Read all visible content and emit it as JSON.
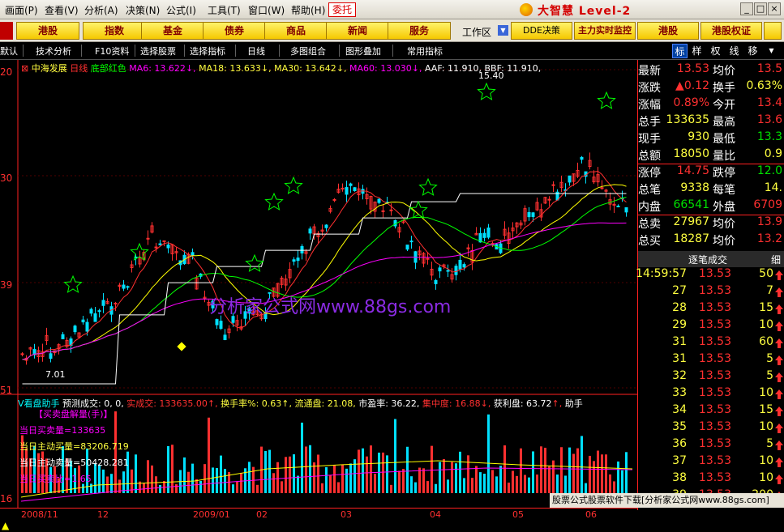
{
  "menu": {
    "items": [
      "画面(P)",
      "查看(V)",
      "分析(A)",
      "决策(N)",
      "公式(I)",
      "工具(T)",
      "窗口(W)",
      "帮助(H)"
    ],
    "entrust": "委托",
    "brand": "大智慧 Level-2"
  },
  "nav": {
    "buttons": [
      "港股",
      "指数",
      "基金",
      "债券",
      "商品",
      "新闻",
      "服务"
    ],
    "workarea": "工作区",
    "right_buttons": [
      "DDE决策",
      "主力实时监控",
      "港股",
      "港股权证"
    ]
  },
  "toolbar": {
    "items": [
      "默认",
      "技术分析",
      "F10资料",
      "选择股票",
      "选择指标",
      "日线",
      "多图组合",
      "图形叠加",
      "常用指标"
    ],
    "side_tabs": [
      "标",
      "样",
      "权",
      "线",
      "移"
    ]
  },
  "chart": {
    "stock_name": "中海发展",
    "period": "日线",
    "indicator": "底部红色",
    "ma6": "MA6: 13.622",
    "ma18": "MA18: 13.633",
    "ma30": "MA30: 13.642",
    "ma60": "MA60: 13.030",
    "aaf": "AAF: 11.910,",
    "bbf": "BBF: 11.910,",
    "high_mark": "15.40",
    "low_mark": "7.01",
    "axis": [
      "20",
      "30",
      "39",
      "51",
      "16"
    ],
    "watermark": "分析家公式网www.88gs.com"
  },
  "vol_panel": {
    "title": "V看盘助手",
    "predict": "预测成交: 0, 0,",
    "actual": "实成交: 133635.00",
    "turnover": "换手率%: 0.63",
    "float_cap": "流通盘: 21.08",
    "pe": "市盈率: 36.22",
    "concentration": "集中度: 16.88",
    "profit": "获利盘: 63.72",
    "helper": "助手",
    "subtitle": "【买卖盘解量(手)】",
    "lines": [
      "当日买卖量=133635",
      "当日主动买量=83206.719",
      "当日主动卖量=50428.281",
      "当日买卖比=1.65"
    ]
  },
  "timeline": {
    "months": [
      "2008/11",
      "12",
      "2009/01",
      "02",
      "03",
      "04",
      "05",
      "06"
    ]
  },
  "quote": {
    "rows": [
      {
        "l1": "最新",
        "v1": "13.53",
        "l2": "均价",
        "v2": "13.5",
        "c1": "#ff3030",
        "c2": "#ff3030"
      },
      {
        "l1": "涨跌",
        "v1": "▲0.12",
        "l2": "换手",
        "v2": "0.63%",
        "c1": "#ff3030",
        "c2": "#ffff40"
      },
      {
        "l1": "涨幅",
        "v1": "0.89%",
        "l2": "今开",
        "v2": "13.4",
        "c1": "#ff3030",
        "c2": "#ff3030"
      },
      {
        "l1": "总手",
        "v1": "133635",
        "l2": "最高",
        "v2": "13.6",
        "c1": "#ffff40",
        "c2": "#ff3030"
      },
      {
        "l1": "现手",
        "v1": "930",
        "l2": "最低",
        "v2": "13.3",
        "c1": "#ffff40",
        "c2": "#00e000"
      },
      {
        "l1": "总额",
        "v1": "18050",
        "l2": "量比",
        "v2": "0.9",
        "c1": "#ffff40",
        "c2": "#ffff40"
      },
      {
        "l1": "涨停",
        "v1": "14.75",
        "l2": "跌停",
        "v2": "12.0",
        "c1": "#ff3030",
        "c2": "#00e000"
      },
      {
        "l1": "总笔",
        "v1": "9338",
        "l2": "每笔",
        "v2": "14.",
        "c1": "#ffff40",
        "c2": "#ffff40"
      },
      {
        "l1": "内盘",
        "v1": "66541",
        "l2": "外盘",
        "v2": "6709",
        "c1": "#00e000",
        "c2": "#ff3030"
      },
      {
        "l1": "总卖",
        "v1": "27967",
        "l2": "均价",
        "v2": "13.9",
        "c1": "#ffff40",
        "c2": "#ff3030"
      },
      {
        "l1": "总买",
        "v1": "18287",
        "l2": "均价",
        "v2": "13.2",
        "c1": "#ffff40",
        "c2": "#ff3030"
      }
    ]
  },
  "ticks": {
    "header": "逐笔成交",
    "header2": "细",
    "rows": [
      {
        "time": "14:59:57",
        "price": "13.53",
        "vol": "50",
        "up": true
      },
      {
        "time": "27",
        "price": "13.53",
        "vol": "7",
        "up": true
      },
      {
        "time": "28",
        "price": "13.53",
        "vol": "15",
        "up": true
      },
      {
        "time": "29",
        "price": "13.53",
        "vol": "10",
        "up": true
      },
      {
        "time": "31",
        "price": "13.53",
        "vol": "60",
        "up": true
      },
      {
        "time": "31",
        "price": "13.53",
        "vol": "5",
        "up": true
      },
      {
        "time": "32",
        "price": "13.53",
        "vol": "5",
        "up": true
      },
      {
        "time": "33",
        "price": "13.53",
        "vol": "10",
        "up": true
      },
      {
        "time": "34",
        "price": "13.53",
        "vol": "15",
        "up": true
      },
      {
        "time": "35",
        "price": "13.53",
        "vol": "10",
        "up": true
      },
      {
        "time": "36",
        "price": "13.53",
        "vol": "5",
        "up": true
      },
      {
        "time": "37",
        "price": "13.53",
        "vol": "10",
        "up": true
      },
      {
        "time": "38",
        "price": "13.53",
        "vol": "10",
        "up": true
      },
      {
        "time": "39",
        "price": "13.53",
        "vol": "200",
        "up": true
      }
    ]
  },
  "footer": {
    "banner": "股票公式股票软件下载[分析家公式网www.88gs.com]"
  },
  "colors": {
    "up": "#ff3030",
    "down": "#00e0ff",
    "ma6": "#ffffff",
    "ma18": "#ffff00",
    "ma30": "#00ff00",
    "ma60": "#ff00ff"
  }
}
